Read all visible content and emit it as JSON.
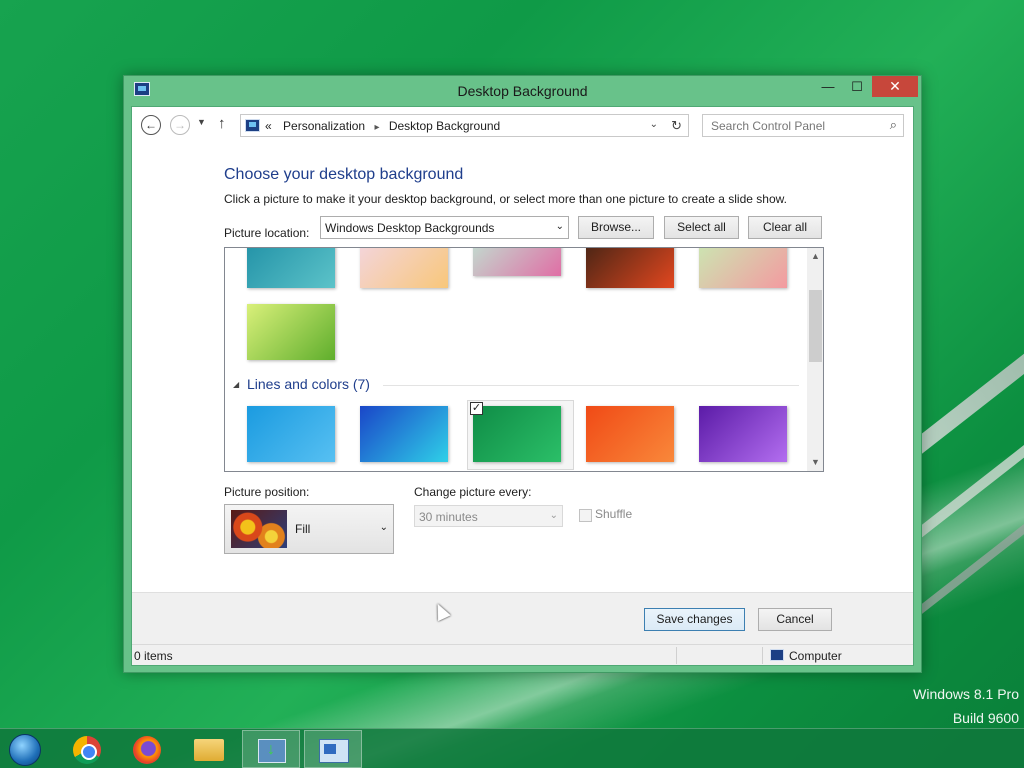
{
  "window": {
    "title": "Desktop Background",
    "minimize": "—",
    "maximize": "☐",
    "close": "✕"
  },
  "nav": {
    "back": "←",
    "forward": "→",
    "recent": "▼",
    "up": "↑",
    "overflow": "«",
    "breadcrumb": [
      "Personalization",
      "Desktop Background"
    ],
    "breadcrumb_sep": "▸",
    "dropdown": "⌄",
    "refresh": "↻",
    "search_placeholder": "Search Control Panel",
    "search_glyph": "⌕"
  },
  "main": {
    "heading": "Choose your desktop background",
    "subtext": "Click a picture to make it your desktop background, or select more than one picture to create a slide show.",
    "picture_location_label": "Picture location:",
    "picture_location_value": "Windows Desktop Backgrounds",
    "select_arrow": "⌄",
    "browse_label": "Browse...",
    "select_all_label": "Select all",
    "clear_all_label": "Clear all"
  },
  "gallery": {
    "scroll_up": "▲",
    "scroll_down": "▼",
    "group_toggle": "◢",
    "group_title": "Lines and colors (7)",
    "selected_check": "✓",
    "flowers_thumbs": [
      {
        "colors": [
          "#1f8fa5",
          "#5cc3c9"
        ]
      },
      {
        "colors": [
          "#f3d6e4",
          "#f8c77a"
        ]
      },
      {
        "colors": [
          "#bfe4d3",
          "#e06ea5"
        ]
      },
      {
        "colors": [
          "#3d2214",
          "#e2471f"
        ]
      },
      {
        "colors": [
          "#c8ecb3",
          "#f39aa0"
        ]
      },
      {
        "colors": [
          "#d9f07a",
          "#5fae2c"
        ]
      }
    ],
    "lines_thumbs": [
      {
        "colors": [
          "#1b9be0",
          "#57c0f2"
        ]
      },
      {
        "colors": [
          "#1a46c8",
          "#2fd0e8"
        ]
      },
      {
        "colors": [
          "#0f8c46",
          "#2bbf68"
        ]
      },
      {
        "colors": [
          "#f04a16",
          "#f9883a"
        ]
      },
      {
        "colors": [
          "#5b1ba7",
          "#b36ef0"
        ]
      }
    ]
  },
  "options": {
    "position_label": "Picture position:",
    "position_value": "Fill",
    "change_label": "Change picture every:",
    "change_value": "30 minutes",
    "shuffle_label": "Shuffle"
  },
  "footer": {
    "save_label": "Save changes",
    "cancel_label": "Cancel"
  },
  "status": {
    "items": "0 items",
    "location": "Computer"
  },
  "desktop": {
    "watermark_line1": "Windows 8.1 Pro",
    "watermark_line2": "Build 9600"
  }
}
